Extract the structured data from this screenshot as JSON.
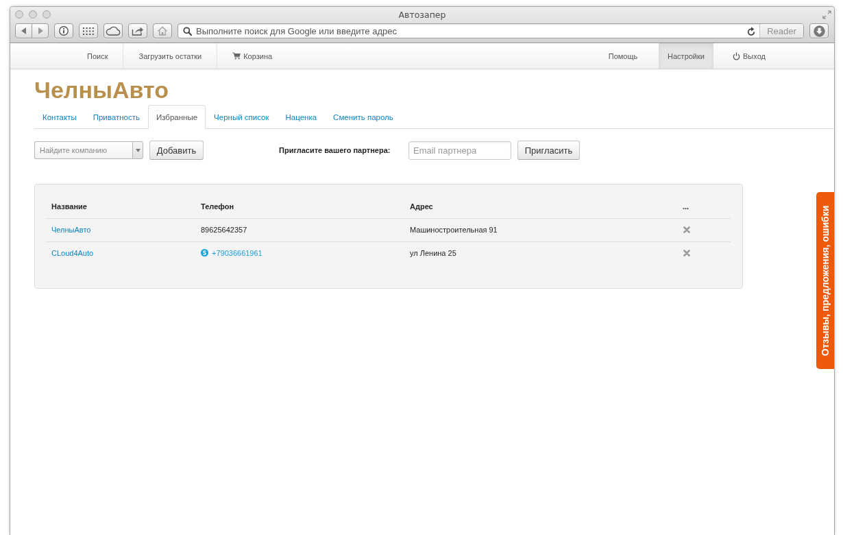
{
  "window": {
    "title": "Автозапер"
  },
  "browser_toolbar": {
    "address_field": {
      "placeholder": "Выполните поиск для Google или введите адрес"
    },
    "reader_button": {
      "label": "Reader",
      "disabled": true
    }
  },
  "navbar": {
    "left_items": [
      {
        "label": "Поиск",
        "kind": "text",
        "selected": false
      },
      {
        "label": "Загрузить остатки",
        "kind": "text",
        "selected": false
      },
      {
        "label": "Корзина",
        "kind": "cart",
        "selected": false
      }
    ],
    "right_items": [
      {
        "label": "Помощь",
        "kind": "text",
        "selected": false
      },
      {
        "label": "Настройки",
        "kind": "text",
        "selected": true
      },
      {
        "label": "Выход",
        "kind": "power",
        "selected": false
      }
    ]
  },
  "logo": "ЧелныАвто",
  "tabs": [
    {
      "label": "Контакты",
      "selected": false
    },
    {
      "label": "Приватность",
      "selected": false
    },
    {
      "label": "Избранные",
      "selected": true
    },
    {
      "label": "Черный список",
      "selected": false
    },
    {
      "label": "Наценка",
      "selected": false
    },
    {
      "label": "Сменить пароль",
      "selected": false
    }
  ],
  "company_search": {
    "placeholder": "Найдите компанию",
    "button": "Добавить"
  },
  "invite": {
    "label": "Пригласите вашего партнера:",
    "placeholder": "Email партнера",
    "button": "Пригласить"
  },
  "table": {
    "columns": [
      "Название",
      "Телефон",
      "Адрес",
      "..."
    ],
    "rows": [
      {
        "name": "ЧелныАвто",
        "phone": {
          "kind": "text",
          "text": "89625642357"
        },
        "address": "Машиностроительная 91"
      },
      {
        "name": "CLoud4Auto",
        "phone": {
          "kind": "link",
          "text": "+79036661961"
        },
        "address": "ул Ленина 25"
      }
    ]
  },
  "feedback_tab": {
    "label": "Отзывы, предложения, ошибки"
  }
}
